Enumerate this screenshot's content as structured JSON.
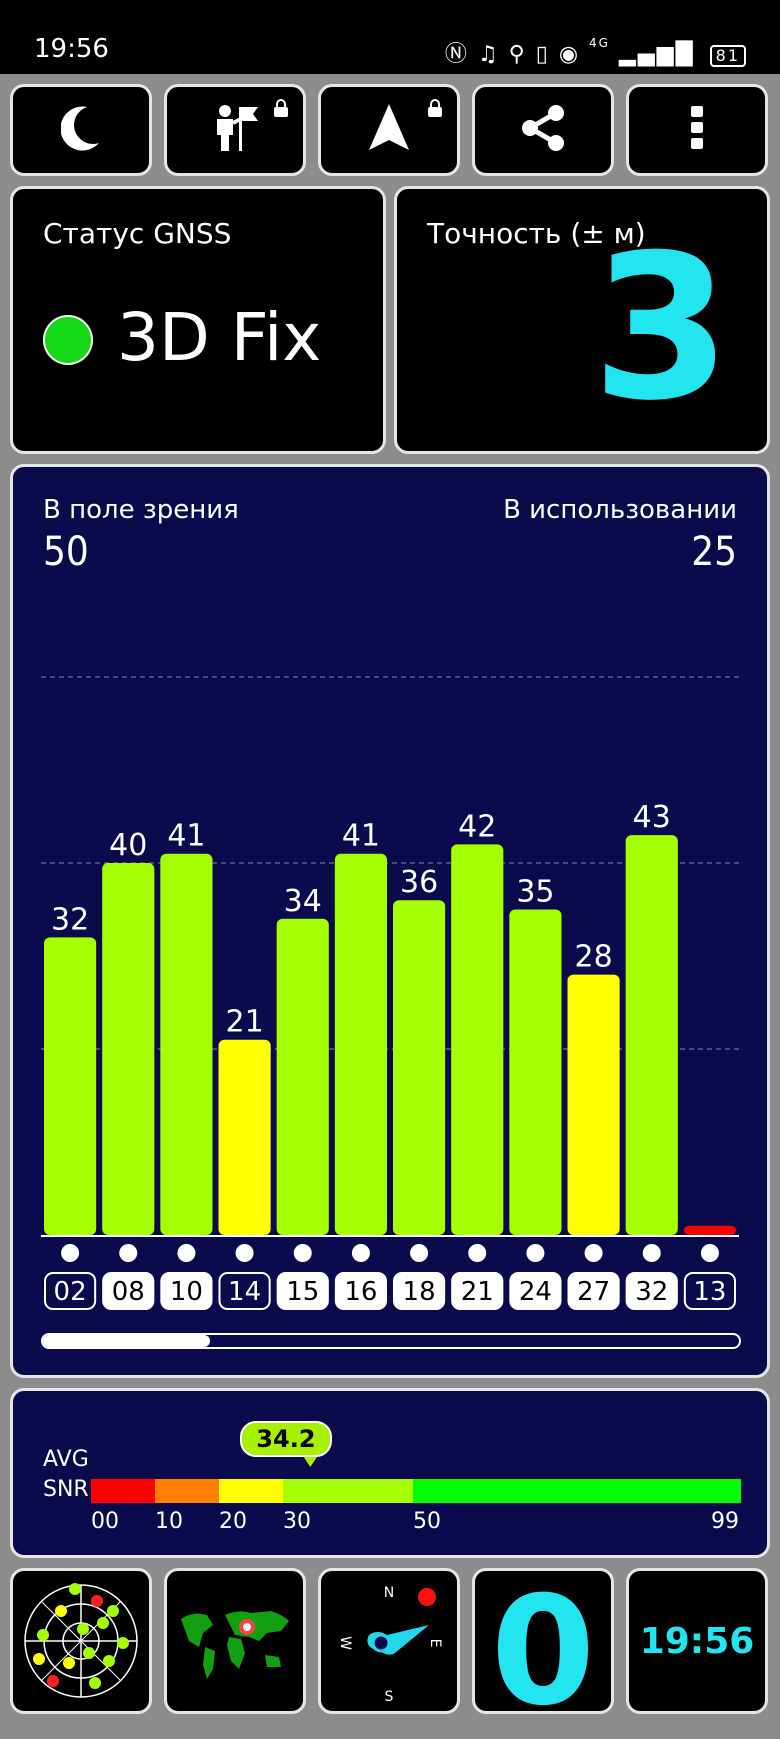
{
  "status_bar": {
    "time": "19:56",
    "battery": "81",
    "network": "4G"
  },
  "toolbar": {
    "buttons": [
      {
        "icon": "moon-icon"
      },
      {
        "icon": "person-flag-icon",
        "locked": true
      },
      {
        "icon": "navigation-arrow-icon",
        "locked": true
      },
      {
        "icon": "share-icon"
      },
      {
        "icon": "more-vert-icon"
      }
    ]
  },
  "gnss_status": {
    "label": "Статус GNSS",
    "value": "3D Fix",
    "indicator_color": "#16d916"
  },
  "accuracy": {
    "label": "Точность (± м)",
    "value": "3",
    "color": "#22e5f0"
  },
  "satellites": {
    "in_view_label": "В поле зрения",
    "in_view": "50",
    "in_use_label": "В использовании",
    "in_use": "25",
    "scroll_position": 0.24
  },
  "chart_data": {
    "type": "bar",
    "categories": [
      "02",
      "08",
      "10",
      "14",
      "15",
      "16",
      "18",
      "21",
      "24",
      "27",
      "32",
      "13"
    ],
    "values": [
      32,
      40,
      41,
      21,
      34,
      41,
      36,
      42,
      35,
      28,
      43,
      1
    ],
    "value_labels": [
      "32",
      "40",
      "41",
      "21",
      "34",
      "41",
      "36",
      "42",
      "35",
      "28",
      "43",
      ""
    ],
    "used_in_fix": [
      false,
      true,
      true,
      false,
      true,
      true,
      true,
      true,
      true,
      true,
      true,
      false
    ],
    "colors": [
      "#a6ff00",
      "#a6ff00",
      "#a6ff00",
      "#ffff00",
      "#a6ff00",
      "#a6ff00",
      "#a6ff00",
      "#a6ff00",
      "#a6ff00",
      "#ffff00",
      "#a6ff00",
      "#ff0000"
    ],
    "ylim": [
      0,
      60
    ],
    "gridlines": [
      20,
      40,
      60
    ]
  },
  "avg_snr": {
    "label_line1": "AVG",
    "label_line2": "SNR",
    "value": "34.2",
    "numeric_value": 34.2,
    "scale_ticks": [
      "00",
      "10",
      "20",
      "30",
      "50",
      "99"
    ],
    "scale_stops": [
      0,
      10,
      20,
      30,
      50,
      99
    ],
    "segments": [
      {
        "from": 0,
        "to": 10,
        "color": "#ff0000"
      },
      {
        "from": 10,
        "to": 20,
        "color": "#ff8000"
      },
      {
        "from": 20,
        "to": 30,
        "color": "#ffff00"
      },
      {
        "from": 30,
        "to": 50,
        "color": "#a6ff00"
      },
      {
        "from": 50,
        "to": 99,
        "color": "#00ff00"
      }
    ]
  },
  "bottom_tiles": {
    "sky_view_icon": "sky-plot-icon",
    "map_icon": "world-map-icon",
    "compass": {
      "n": "N",
      "e": "E",
      "s": "S",
      "w": "W"
    },
    "counter": "0",
    "clock": "19:56"
  }
}
